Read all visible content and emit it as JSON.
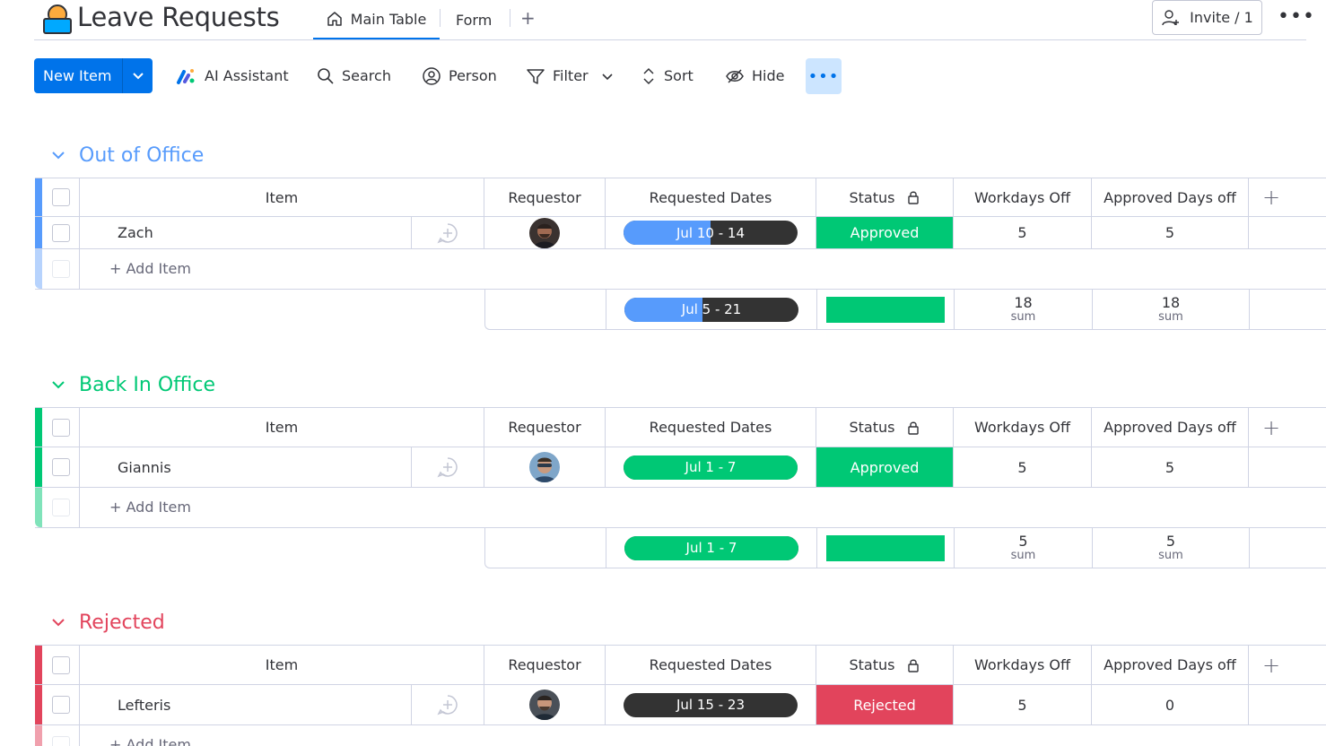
{
  "header": {
    "title": "Leave Requests",
    "tabs": [
      {
        "label": "Main Table"
      },
      {
        "label": "Form"
      }
    ],
    "invite_label": "Invite / 1"
  },
  "toolbar": {
    "new_item": "New Item",
    "ai_assistant": "AI Assistant",
    "search": "Search",
    "person": "Person",
    "filter": "Filter",
    "sort": "Sort",
    "hide": "Hide"
  },
  "columns": {
    "item": "Item",
    "requestor": "Requestor",
    "requested_dates": "Requested Dates",
    "status": "Status",
    "workdays_off": "Workdays Off",
    "approved_days_off": "Approved Days off"
  },
  "add_item_label": "+ Add Item",
  "sum_label": "sum",
  "colors": {
    "blue": "#579bfc",
    "green": "#00c875",
    "red": "#e2445c",
    "dark": "#333333",
    "primary": "#0073ea"
  },
  "groups": [
    {
      "name": "Out of Office",
      "color": "#579bfc",
      "rows": [
        {
          "item": "Zach",
          "dates": "Jul 10 - 14",
          "timeline_progress": 0.5,
          "status": "Approved",
          "workdays_off": "5",
          "approved_days_off": "5"
        }
      ],
      "summary": {
        "dates": "Jul 5 - 21",
        "timeline_progress": 0.45,
        "workdays_off": "18",
        "approved_days_off": "18"
      }
    },
    {
      "name": "Back In Office",
      "color": "#00c875",
      "rows": [
        {
          "item": "Giannis",
          "dates": "Jul 1 - 7",
          "timeline_progress": 1.0,
          "status": "Approved",
          "workdays_off": "5",
          "approved_days_off": "5"
        }
      ],
      "summary": {
        "dates": "Jul 1 - 7",
        "timeline_progress": 1.0,
        "workdays_off": "5",
        "approved_days_off": "5"
      }
    },
    {
      "name": "Rejected",
      "color": "#e2445c",
      "rows": [
        {
          "item": "Lefteris",
          "dates": "Jul 15 - 23",
          "timeline_progress": 0.0,
          "status": "Rejected",
          "workdays_off": "5",
          "approved_days_off": "0"
        }
      ]
    }
  ]
}
